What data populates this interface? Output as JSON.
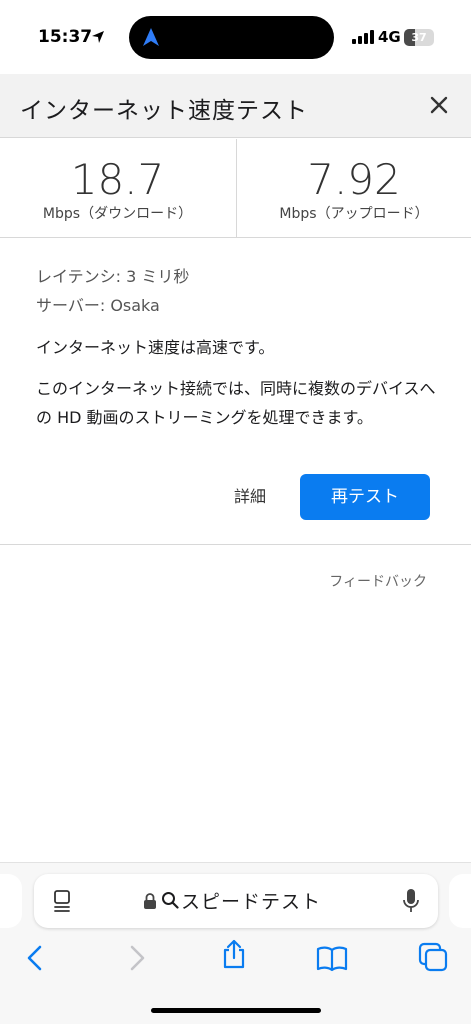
{
  "status_bar": {
    "time": "15:37",
    "network": "4G",
    "battery": "37",
    "battery_level": 0.37
  },
  "panel": {
    "title": "インターネット速度テスト"
  },
  "speeds": {
    "download_value": "18.7",
    "download_unit": "Mbps（ダウンロード）",
    "upload_value": "7.92",
    "upload_unit": "Mbps（アップロード）"
  },
  "info": {
    "latency": "レイテンシ: 3 ミリ秒",
    "server": "サーバー: Osaka",
    "message1": "インターネット速度は高速です。",
    "message2": "このインターネット接続では、同時に複数のデバイスへの HD 動画のストリーミングを処理できます。"
  },
  "actions": {
    "details_label": "詳細",
    "retest_label": "再テスト",
    "feedback_label": "フィードバック"
  },
  "safari": {
    "address_text": "スピードテスト"
  },
  "colors": {
    "accent": "#0a7cf0"
  },
  "icons": [
    "location-arrow-icon",
    "navigation-app-icon",
    "signal-icon",
    "battery-icon",
    "close-icon",
    "reader-icon",
    "lock-icon",
    "search-icon",
    "microphone-icon",
    "back-icon",
    "forward-icon",
    "share-icon",
    "bookmarks-icon",
    "tabs-icon"
  ]
}
